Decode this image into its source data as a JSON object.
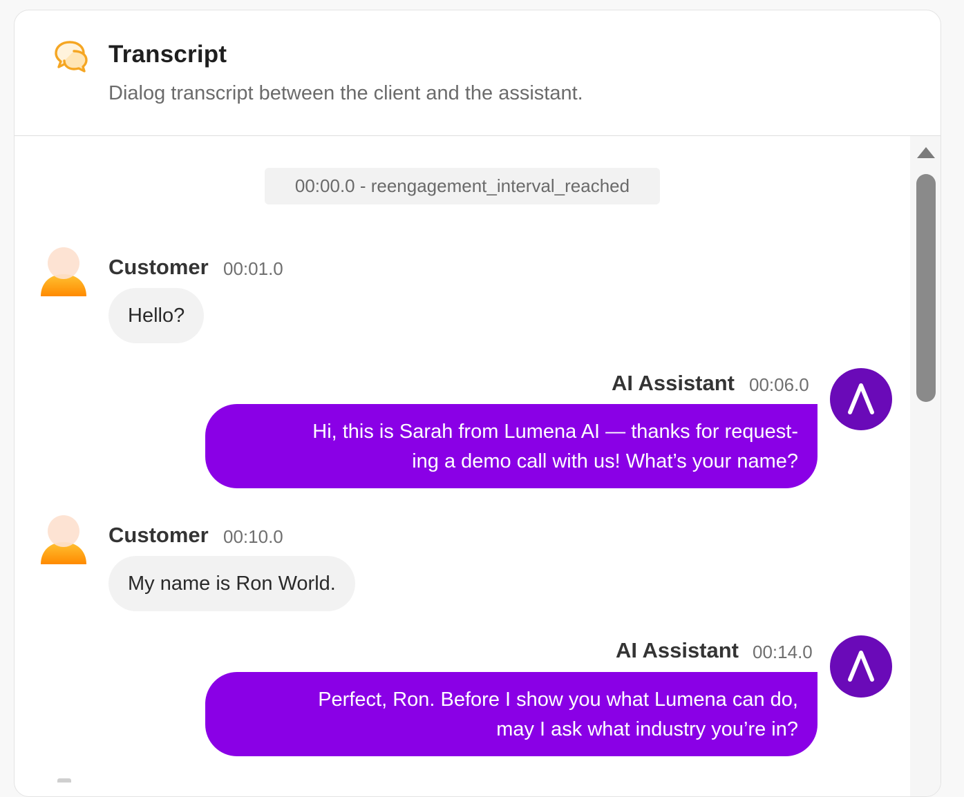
{
  "header": {
    "icon": "chat-bubbles-icon",
    "title": "Transcript",
    "subtitle": "Dialog transcript between the client and the assistant."
  },
  "colors": {
    "accent_icon": "#f5a623",
    "ai_bubble": "#8a00e6",
    "ai_avatar": "#6a0ab8",
    "customer_bubble": "#f2f2f2"
  },
  "event": {
    "label": "00:00.0 - reengagement_interval_reached"
  },
  "messages": [
    {
      "speaker": "Customer",
      "time": "00:01.0",
      "role": "customer",
      "lines": [
        "Hello?"
      ]
    },
    {
      "speaker": "AI Assistant",
      "time": "00:06.0",
      "role": "assistant",
      "lines": [
        "Hi, this is Sarah from Lumena AI — thanks for request-",
        "ing a demo call with us! What’s your name?"
      ]
    },
    {
      "speaker": "Customer",
      "time": "00:10.0",
      "role": "customer",
      "lines": [
        "My name is Ron World."
      ]
    },
    {
      "speaker": "AI Assistant",
      "time": "00:14.0",
      "role": "assistant",
      "lines": [
        "Perfect, Ron. Before I show you what Lumena can do,",
        "may I ask what industry you’re in?"
      ]
    }
  ],
  "avatar_ai_glyph": "Λ",
  "scrollbar": {
    "up_icon": "scroll-up-arrow-icon"
  }
}
